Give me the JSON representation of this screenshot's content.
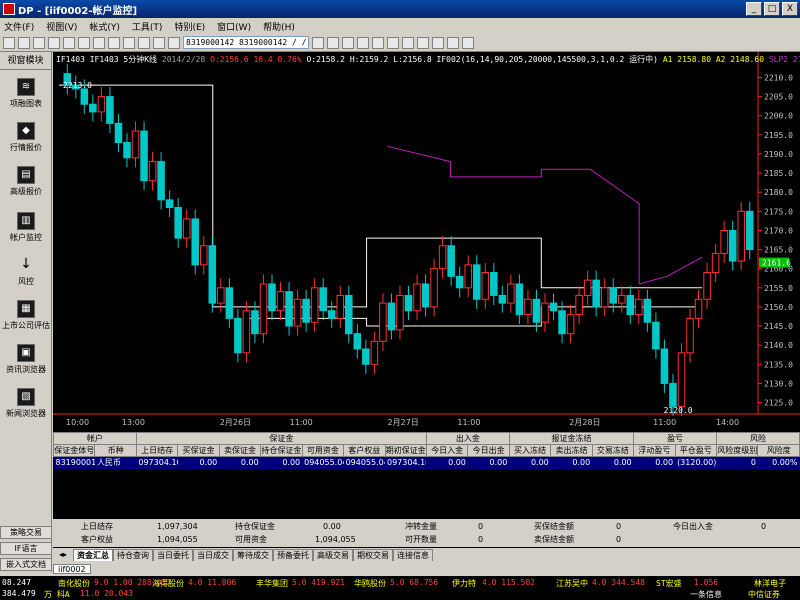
{
  "window": {
    "title": "DP - [iif0002-帐户监控]",
    "min": "_",
    "max": "□",
    "close": "X"
  },
  "menu": [
    "文件(F)",
    "视图(V)",
    "帐式(Y)",
    "工具(T)",
    "特别(E)",
    "窗口(W)",
    "帮助(H)"
  ],
  "toolbar": {
    "account_combo": "8319000142 8319000142 / / "
  },
  "sidebar": {
    "header": "视窗模块",
    "items": [
      "项融图表",
      "行情报价",
      "高级报价",
      "帐户监控",
      "风控",
      "上市公司评估",
      "资讯浏览器",
      "新闻浏览器"
    ],
    "bottom": [
      "策略交易",
      "IF语言",
      "嵌入式文档"
    ]
  },
  "chart": {
    "info_line": [
      {
        "text": "IF1403 IF1403 5分钟K线",
        "color": "#ffffff"
      },
      {
        "text": "2014/2/28",
        "color": "#a0a0a0"
      },
      {
        "text": "O:2156.6",
        "color": "#ff4040"
      },
      {
        "text": "16.4",
        "color": "#ff4040"
      },
      {
        "text": "0.76%",
        "color": "#ff4040"
      },
      {
        "text": "O:2158.2",
        "color": "#ffffff"
      },
      {
        "text": "H:2159.2",
        "color": "#ffffff"
      },
      {
        "text": "L:2156.8",
        "color": "#ffffff"
      },
      {
        "text": "IF002(16,14,90,205,20000,145500,3,1,0.2 运行中)",
        "color": "#ffffff"
      },
      {
        "text": "A1 2158.80",
        "color": "#ffff00"
      },
      {
        "text": "A2 2148.60",
        "color": "#ffff00"
      },
      {
        "text": "SLP2 2158.60",
        "color": "#d030d0"
      }
    ],
    "peak_label": "2213.0",
    "low_label": "2120.0",
    "last_price": "2161.6",
    "colors": {
      "up": "#ff3030",
      "down": "#00c8c8",
      "bands": "#ffffe0",
      "stop_line": "#c020c0",
      "price_box": "#00c000"
    }
  },
  "chart_data": {
    "type": "candlestick",
    "ylim": [
      2122,
      2213
    ],
    "y_ticks": [
      2210,
      2205,
      2200,
      2195,
      2190,
      2185,
      2180,
      2175,
      2170,
      2165,
      2160,
      2155,
      2150,
      2145,
      2140,
      2135,
      2130,
      2125
    ],
    "x_ticks": [
      "10:00",
      "13:00",
      "2月26日",
      "11:00",
      "2月27日",
      "11:00",
      "2月28日",
      "11:00",
      "14:00"
    ],
    "close": [
      2208,
      2207,
      2203,
      2201,
      2205,
      2198,
      2193,
      2189,
      2196,
      2183,
      2188,
      2178,
      2176,
      2168,
      2173,
      2161,
      2166,
      2151,
      2155,
      2147,
      2138,
      2149,
      2143,
      2156,
      2149,
      2154,
      2145,
      2152,
      2146,
      2155,
      2149,
      2147,
      2153,
      2143,
      2139,
      2135,
      2141,
      2151,
      2144,
      2153,
      2149,
      2156,
      2150,
      2160,
      2166,
      2158,
      2155,
      2161,
      2152,
      2159,
      2153,
      2151,
      2156,
      2148,
      2152,
      2146,
      2151,
      2149,
      2143,
      2148,
      2153,
      2157,
      2150,
      2155,
      2151,
      2153,
      2148,
      2152,
      2146,
      2139,
      2130,
      2124,
      2138,
      2147,
      2152,
      2159,
      2164,
      2170,
      2162,
      2175,
      2165
    ],
    "overlays": {
      "upper_band": [
        [
          0.27,
          2150
        ],
        [
          0.44,
          2150
        ],
        [
          0.44,
          2168
        ],
        [
          0.69,
          2168
        ],
        [
          0.69,
          2155
        ],
        [
          0.92,
          2155
        ]
      ],
      "lower_band": [
        [
          0.27,
          2147
        ],
        [
          0.44,
          2147
        ],
        [
          0.44,
          2145
        ],
        [
          0.69,
          2145
        ],
        [
          0.69,
          2150
        ],
        [
          0.92,
          2150
        ]
      ],
      "stop_line": [
        [
          0.47,
          2192
        ],
        [
          0.56,
          2188
        ],
        [
          0.56,
          2184
        ],
        [
          0.69,
          2184
        ],
        [
          0.69,
          2186
        ],
        [
          0.76,
          2186
        ],
        [
          0.83,
          2177
        ],
        [
          0.83,
          2156
        ],
        [
          0.87,
          2158
        ],
        [
          0.92,
          2163
        ]
      ]
    }
  },
  "grid": {
    "groups": [
      {
        "label": "帐户",
        "span": 2
      },
      {
        "label": "保证金",
        "span": 7
      },
      {
        "label": "出入金",
        "span": 2
      },
      {
        "label": "报证金冻结",
        "span": 3
      },
      {
        "label": "盈亏",
        "span": 2
      },
      {
        "label": "风险",
        "span": 2
      }
    ],
    "columns": [
      "保证金体号",
      "币种",
      "上日结存",
      "买保证金",
      "卖保证金",
      "持仓保证金",
      "可用资金",
      "客户权益",
      "期初保证金",
      "今日入金",
      "今日出金",
      "买入冻结",
      "卖出冻结",
      "交易冻结",
      "浮动盈亏",
      "平仓盈亏",
      "风险度级别",
      "风险度"
    ],
    "rows": [
      [
        "8319000142",
        "人民币",
        "097304.10",
        "0.00",
        "0.00",
        "0.00",
        "094055.04",
        "094055.04",
        "097304.10",
        "0.00",
        "0.00",
        "0.00",
        "0.00",
        "0.00",
        "0.00",
        "(3120.00)",
        "0",
        "0.00%"
      ]
    ]
  },
  "summary": [
    {
      "label": "上日结存",
      "value": "1,097,304"
    },
    {
      "label": "客户权益",
      "value": "1,094,055"
    },
    {
      "label": "持仓保证金",
      "value": "0.00"
    },
    {
      "label": "可用资金",
      "value": "1,094,055"
    },
    {
      "label": "冲转金量",
      "value": "0"
    },
    {
      "label": "可开数量",
      "value": "0"
    },
    {
      "label": "买保结金额",
      "value": "0"
    },
    {
      "label": "卖保结金额",
      "value": "0"
    },
    {
      "label": "今日出入金",
      "value": "0"
    }
  ],
  "tabs": [
    "资金汇总",
    "持仓查询",
    "当日委托",
    "当日成交",
    "筹待成交",
    "预备委托",
    "高级交易",
    "期权交易",
    "连接信息"
  ],
  "account_tab": "iif0002",
  "ticker": [
    {
      "text": "08.247",
      "color": "#ffffff"
    },
    {
      "text": "南化股份",
      "color": "#ffff00"
    },
    {
      "text": "9.0 1.00 288.037",
      "color": "#ff4040"
    },
    {
      "text": "海得股份",
      "color": "#ffff00"
    },
    {
      "text": "4.0 11.806",
      "color": "#ff4040"
    },
    {
      "text": "丰华集团",
      "color": "#ffff00"
    },
    {
      "text": "5.0 419.921",
      "color": "#ff4040"
    },
    {
      "text": "华鸥股份",
      "color": "#ffff00"
    },
    {
      "text": "5.0 68.756",
      "color": "#ff4040"
    },
    {
      "text": "伊力特",
      "color": "#ffff00"
    },
    {
      "text": "4.0 115.502",
      "color": "#ff4040"
    },
    {
      "text": "江苏吴中",
      "color": "#ffff00"
    },
    {
      "text": "4.0 344.548",
      "color": "#ff4040"
    },
    {
      "text": "ST宏盛",
      "color": "#ffff00"
    },
    {
      "text": "1.056",
      "color": "#ff4040"
    },
    {
      "text": "林洋电子",
      "color": "#ffff00"
    },
    {
      "text": "384.479",
      "color": "#ffffff"
    },
    {
      "text": "万 科A",
      "color": "#ffff00"
    },
    {
      "text": "11.0 20.043",
      "color": "#ff4040"
    },
    {
      "text": "一条信息",
      "color": "#ffffff"
    },
    {
      "text": "中信证券",
      "color": "#ffff00"
    }
  ]
}
